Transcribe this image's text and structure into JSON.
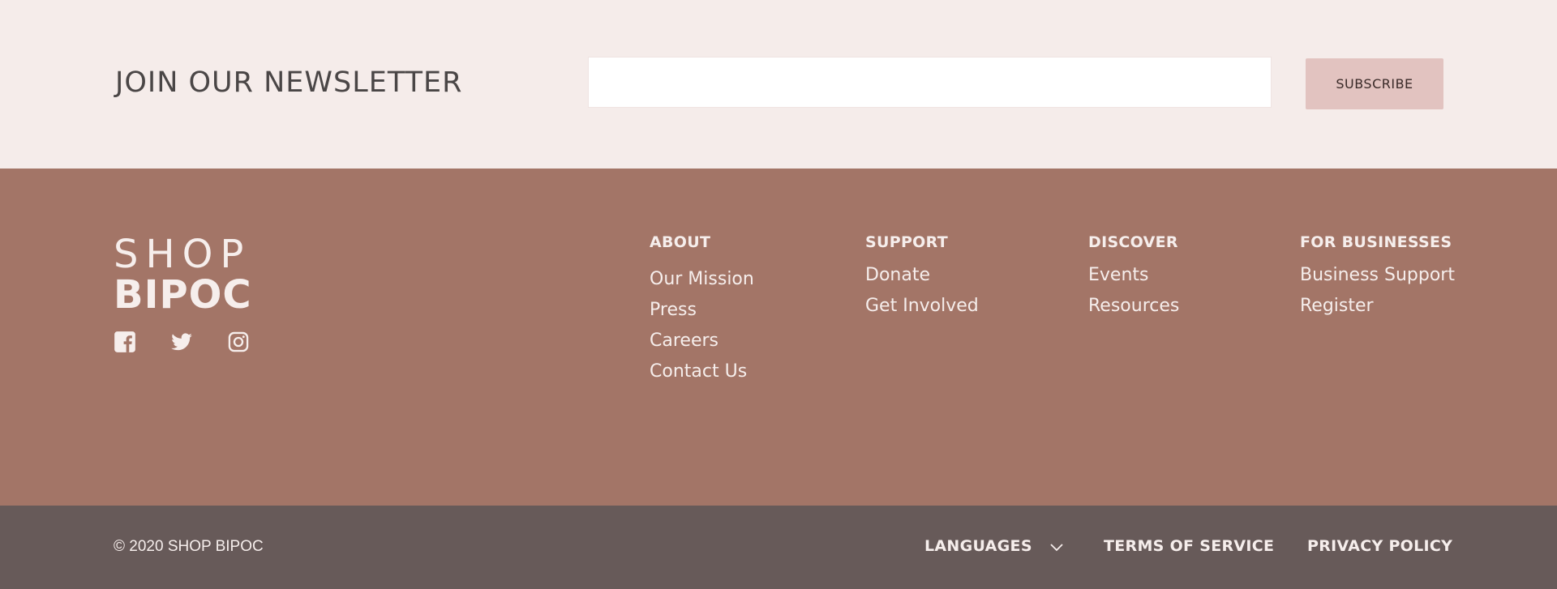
{
  "newsletter": {
    "title": "JOIN OUR NEWSLETTER",
    "input_value": "",
    "input_placeholder": "",
    "button_label": "SUBSCRIBE"
  },
  "brand": {
    "line1": "SHOP",
    "line2": "BIPOC"
  },
  "social": [
    "facebook-icon",
    "twitter-icon",
    "instagram-icon"
  ],
  "columns": [
    {
      "heading": "ABOUT",
      "links": [
        "Our Mission",
        "Press",
        "Careers",
        "Contact Us"
      ]
    },
    {
      "heading": "SUPPORT",
      "links": [
        "Donate",
        "Get Involved"
      ]
    },
    {
      "heading": "DISCOVER",
      "links": [
        "Events",
        "Resources"
      ]
    },
    {
      "heading": "FOR BUSINESSES",
      "links": [
        "Business Support",
        "Register"
      ]
    }
  ],
  "bottom": {
    "copyright": "© 2020 SHOP BIPOC",
    "languages": "LANGUAGES",
    "terms": "TERMS OF SERVICE",
    "privacy": "PRIVACY POLICY"
  },
  "colors": {
    "newsletter_bg": "#f5ecea",
    "footer_bg": "#a37567",
    "bottom_bg": "#675a59",
    "button_bg": "#e2c3c0"
  }
}
